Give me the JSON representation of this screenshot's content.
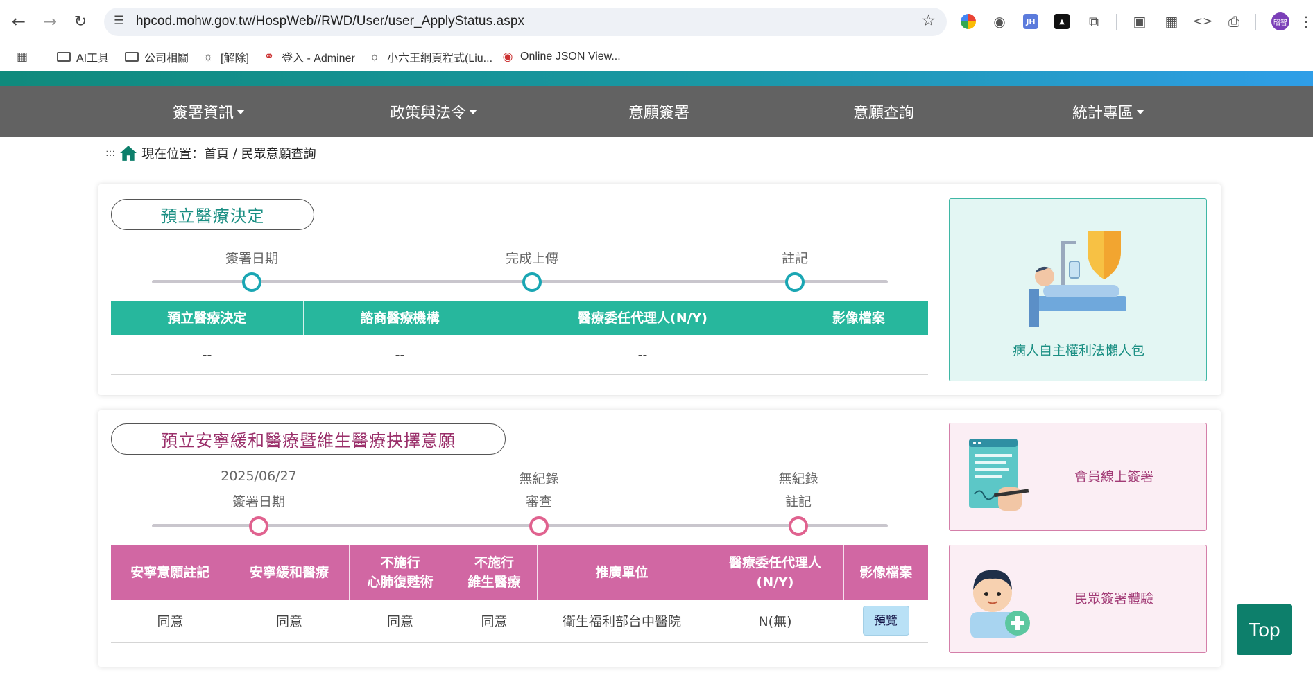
{
  "browser": {
    "url": "hpcod.mohw.gov.tw/HospWeb//RWD/User/user_ApplyStatus.aspx",
    "profile_initials": "昭智",
    "bookmarks": [
      {
        "label": "AI工具",
        "icon": "folder-icon"
      },
      {
        "label": "公司相關",
        "icon": "folder-icon"
      },
      {
        "label": "[解除]",
        "icon": "globe-icon"
      },
      {
        "label": "登入 - Adminer",
        "icon": "adminer-icon"
      },
      {
        "label": "小六王網頁程式(Liu...",
        "icon": "globe-icon"
      },
      {
        "label": "Online JSON View...",
        "icon": "json-viewer-icon"
      }
    ]
  },
  "nav": {
    "items": [
      {
        "label": "簽署資訊",
        "dropdown": true
      },
      {
        "label": "政策與法令",
        "dropdown": true
      },
      {
        "label": "意願簽署",
        "dropdown": false
      },
      {
        "label": "意願查詢",
        "dropdown": false
      },
      {
        "label": "統計專區",
        "dropdown": true
      }
    ]
  },
  "breadcrumb": {
    "anchor": ":::",
    "prefix": "現在位置：",
    "home": "首頁",
    "separator": " / ",
    "current": "民眾意願查詢"
  },
  "acp": {
    "title": "預立醫療決定",
    "steps": [
      "簽署日期",
      "完成上傳",
      "註記"
    ],
    "headers": [
      "預立醫療決定",
      "諮商醫療機構",
      "醫療委任代理人(N/Y)",
      "影像檔案"
    ],
    "row": [
      "--",
      "--",
      "--",
      ""
    ],
    "side_label": "病人自主權利法懶人包"
  },
  "hospice": {
    "title": "預立安寧緩和醫療暨維生醫療抉擇意願",
    "steps": [
      {
        "value": "2025/06/27",
        "label": "簽署日期"
      },
      {
        "value": "無紀錄",
        "label": "審查"
      },
      {
        "value": "無紀錄",
        "label": "註記"
      }
    ],
    "headers": [
      "安寧意願註記",
      "安寧緩和醫療",
      "不施行\n心肺復甦術",
      "不施行\n維生醫療",
      "推廣單位",
      "醫療委任代理人\n(N/Y)",
      "影像檔案"
    ],
    "row": [
      "同意",
      "同意",
      "同意",
      "同意",
      "衛生福利部台中醫院",
      "N(無)"
    ],
    "preview_label": "預覽",
    "side_online_sign": "會員線上簽署",
    "side_experience": "民眾簽署體驗"
  },
  "top_button": "Top",
  "colors": {
    "teal": "#27b79d",
    "pink": "#d167a3",
    "nav_bg": "#626262",
    "top_button": "#0d7f6b"
  }
}
